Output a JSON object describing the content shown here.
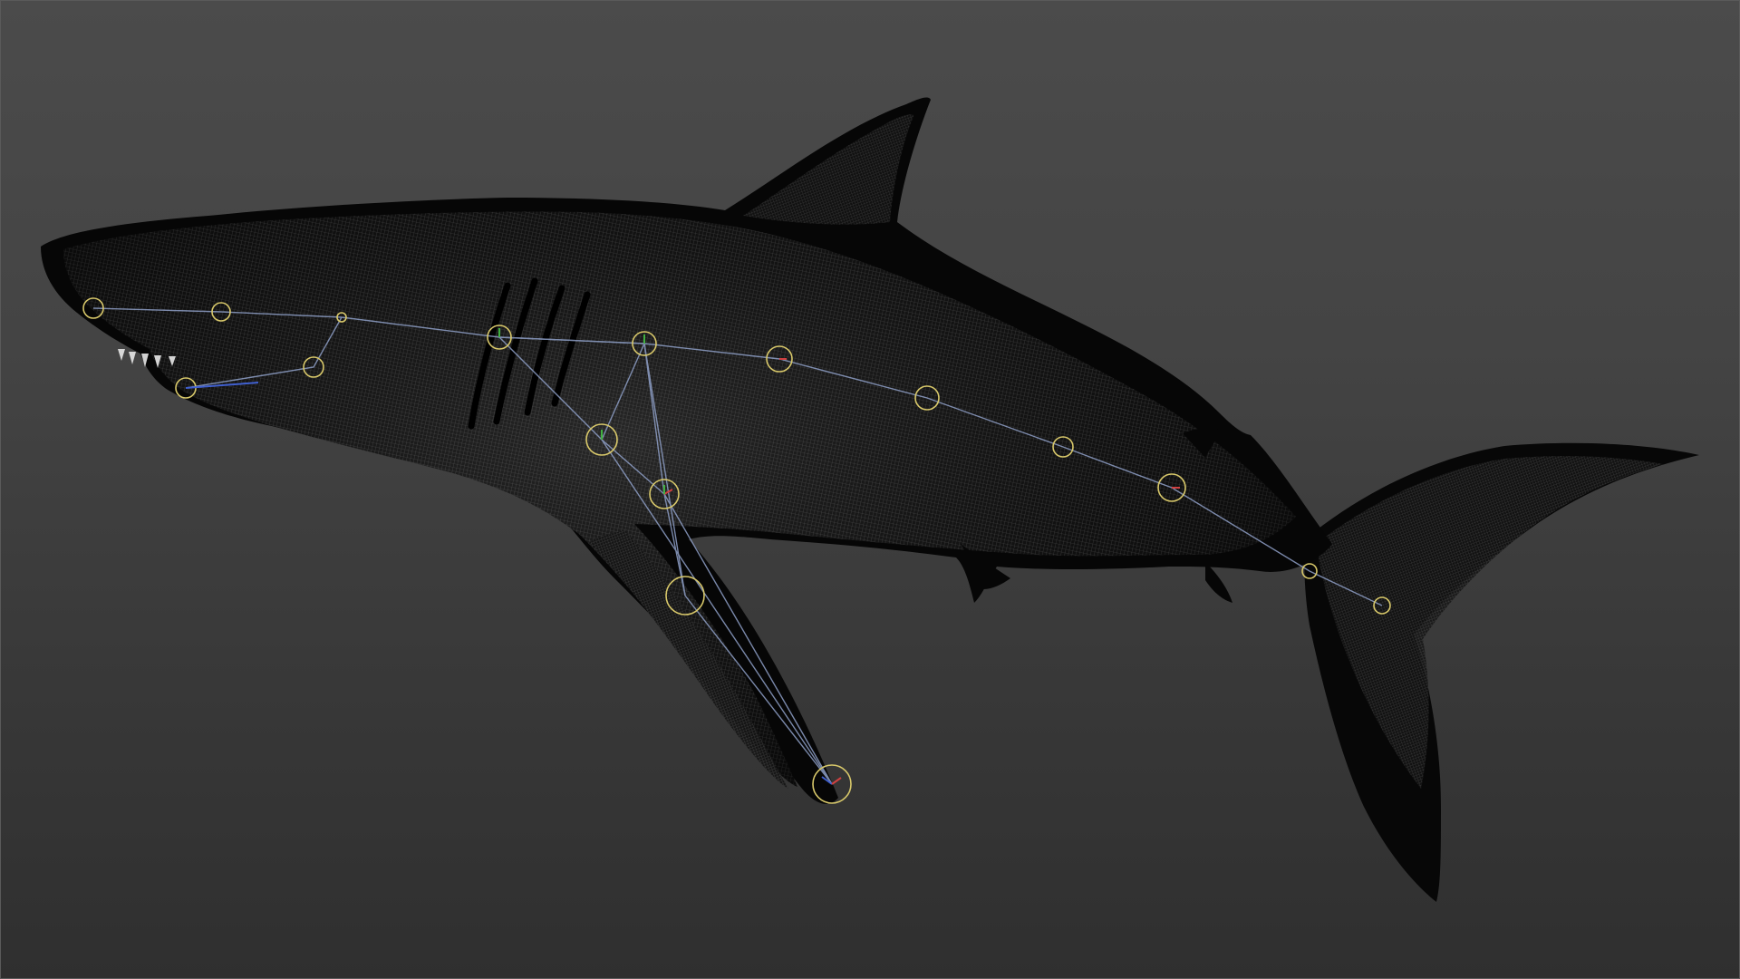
{
  "viewport": {
    "background_top": "#4b4b4b",
    "background_bottom": "#2f2f2f"
  },
  "model": {
    "mesh_color": "#0a0a0a",
    "wire_color": "#5e5e5e"
  },
  "rig": {
    "joint_ring_color": "#d8c86a",
    "bone_color": "#8fa0c8",
    "axis_colors": [
      "#d04040",
      "#40b040",
      "#4060d0"
    ]
  }
}
